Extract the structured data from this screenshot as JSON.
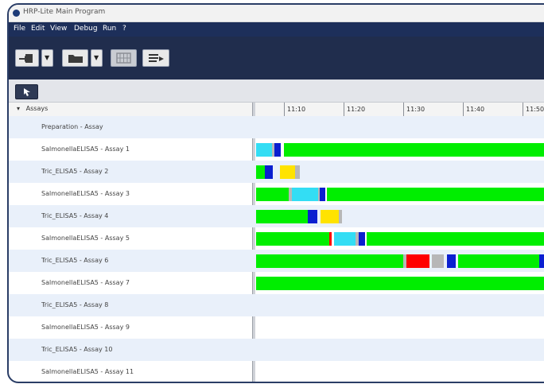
{
  "window": {
    "title": "HRP-Lite Main Program"
  },
  "menu": [
    "File",
    "Edit",
    "View",
    "Debug",
    "Run",
    "?"
  ],
  "toolbar": {
    "buttons": [
      "load-icon",
      "folder-icon",
      "plate-grid-icon",
      "list-sort-icon"
    ]
  },
  "colors": {
    "titlebar": "#f2f2f2",
    "menubar": "#1d2f5a",
    "toolbar": "#202d4d",
    "green": "#00ee00",
    "cyan": "#33ddf4",
    "blue": "#0a1fd0",
    "yellow": "#ffe300",
    "red": "#ff0000",
    "gray": "#b7b7b7"
  },
  "grid": {
    "header": "Assays",
    "times": [
      "11:10",
      "11:20",
      "11:30",
      "11:40",
      "11:50"
    ],
    "rows": [
      {
        "label": "Preparation - Assay",
        "segments": []
      },
      {
        "label": "SalmonellaELISA5 - Assay 1",
        "segments": [
          [
            "cyan",
            0,
            2.7
          ],
          [
            "gray",
            2.7,
            3.1
          ],
          [
            "blue",
            3.1,
            4.1
          ],
          [
            "green",
            4.7,
            50
          ]
        ]
      },
      {
        "label": "Tric_ELISA5 - Assay 2",
        "segments": [
          [
            "green",
            0,
            1.4
          ],
          [
            "blue",
            1.4,
            2.8
          ],
          [
            "yellow",
            4.0,
            6.5
          ],
          [
            "gray",
            6.5,
            7.3
          ]
        ]
      },
      {
        "label": "SalmonellaELISA5 - Assay 3",
        "segments": [
          [
            "green",
            0,
            5.5
          ],
          [
            "gray",
            5.5,
            6.0
          ],
          [
            "cyan",
            6.0,
            10.4
          ],
          [
            "gray",
            10.4,
            10.7
          ],
          [
            "blue",
            10.7,
            11.6
          ],
          [
            "green",
            11.8,
            50
          ]
        ]
      },
      {
        "label": "Tric_ELISA5 - Assay 4",
        "segments": [
          [
            "green",
            0,
            8.7
          ],
          [
            "blue",
            8.7,
            10.3
          ],
          [
            "yellow",
            10.8,
            13.8
          ],
          [
            "gray",
            13.8,
            14.4
          ]
        ]
      },
      {
        "label": "SalmonellaELISA5 - Assay 5",
        "segments": [
          [
            "green",
            0,
            12.3
          ],
          [
            "red",
            12.3,
            12.6
          ],
          [
            "cyan",
            13.0,
            16.7
          ],
          [
            "gray",
            16.7,
            17.2
          ],
          [
            "blue",
            17.2,
            18.3
          ],
          [
            "green",
            18.5,
            50
          ]
        ]
      },
      {
        "label": "Tric_ELISA5 - Assay 6",
        "segments": [
          [
            "green",
            0,
            24.7
          ],
          [
            "gray",
            24.7,
            25.2
          ],
          [
            "red",
            25.2,
            29.0
          ],
          [
            "gray",
            29.5,
            31.5
          ],
          [
            "blue",
            32.0,
            33.4
          ],
          [
            "green",
            33.9,
            47.5
          ],
          [
            "blue",
            47.5,
            50
          ]
        ]
      },
      {
        "label": "SalmonellaELISA5 - Assay 7",
        "segments": [
          [
            "green",
            0,
            50
          ]
        ]
      },
      {
        "label": "Tric_ELISA5 - Assay 8",
        "segments": []
      },
      {
        "label": "SalmonellaELISA5 - Assay 9",
        "segments": []
      },
      {
        "label": "Tric_ELISA5 - Assay 10",
        "segments": []
      },
      {
        "label": "SalmonellaELISA5 - Assay 11",
        "segments": []
      }
    ]
  }
}
